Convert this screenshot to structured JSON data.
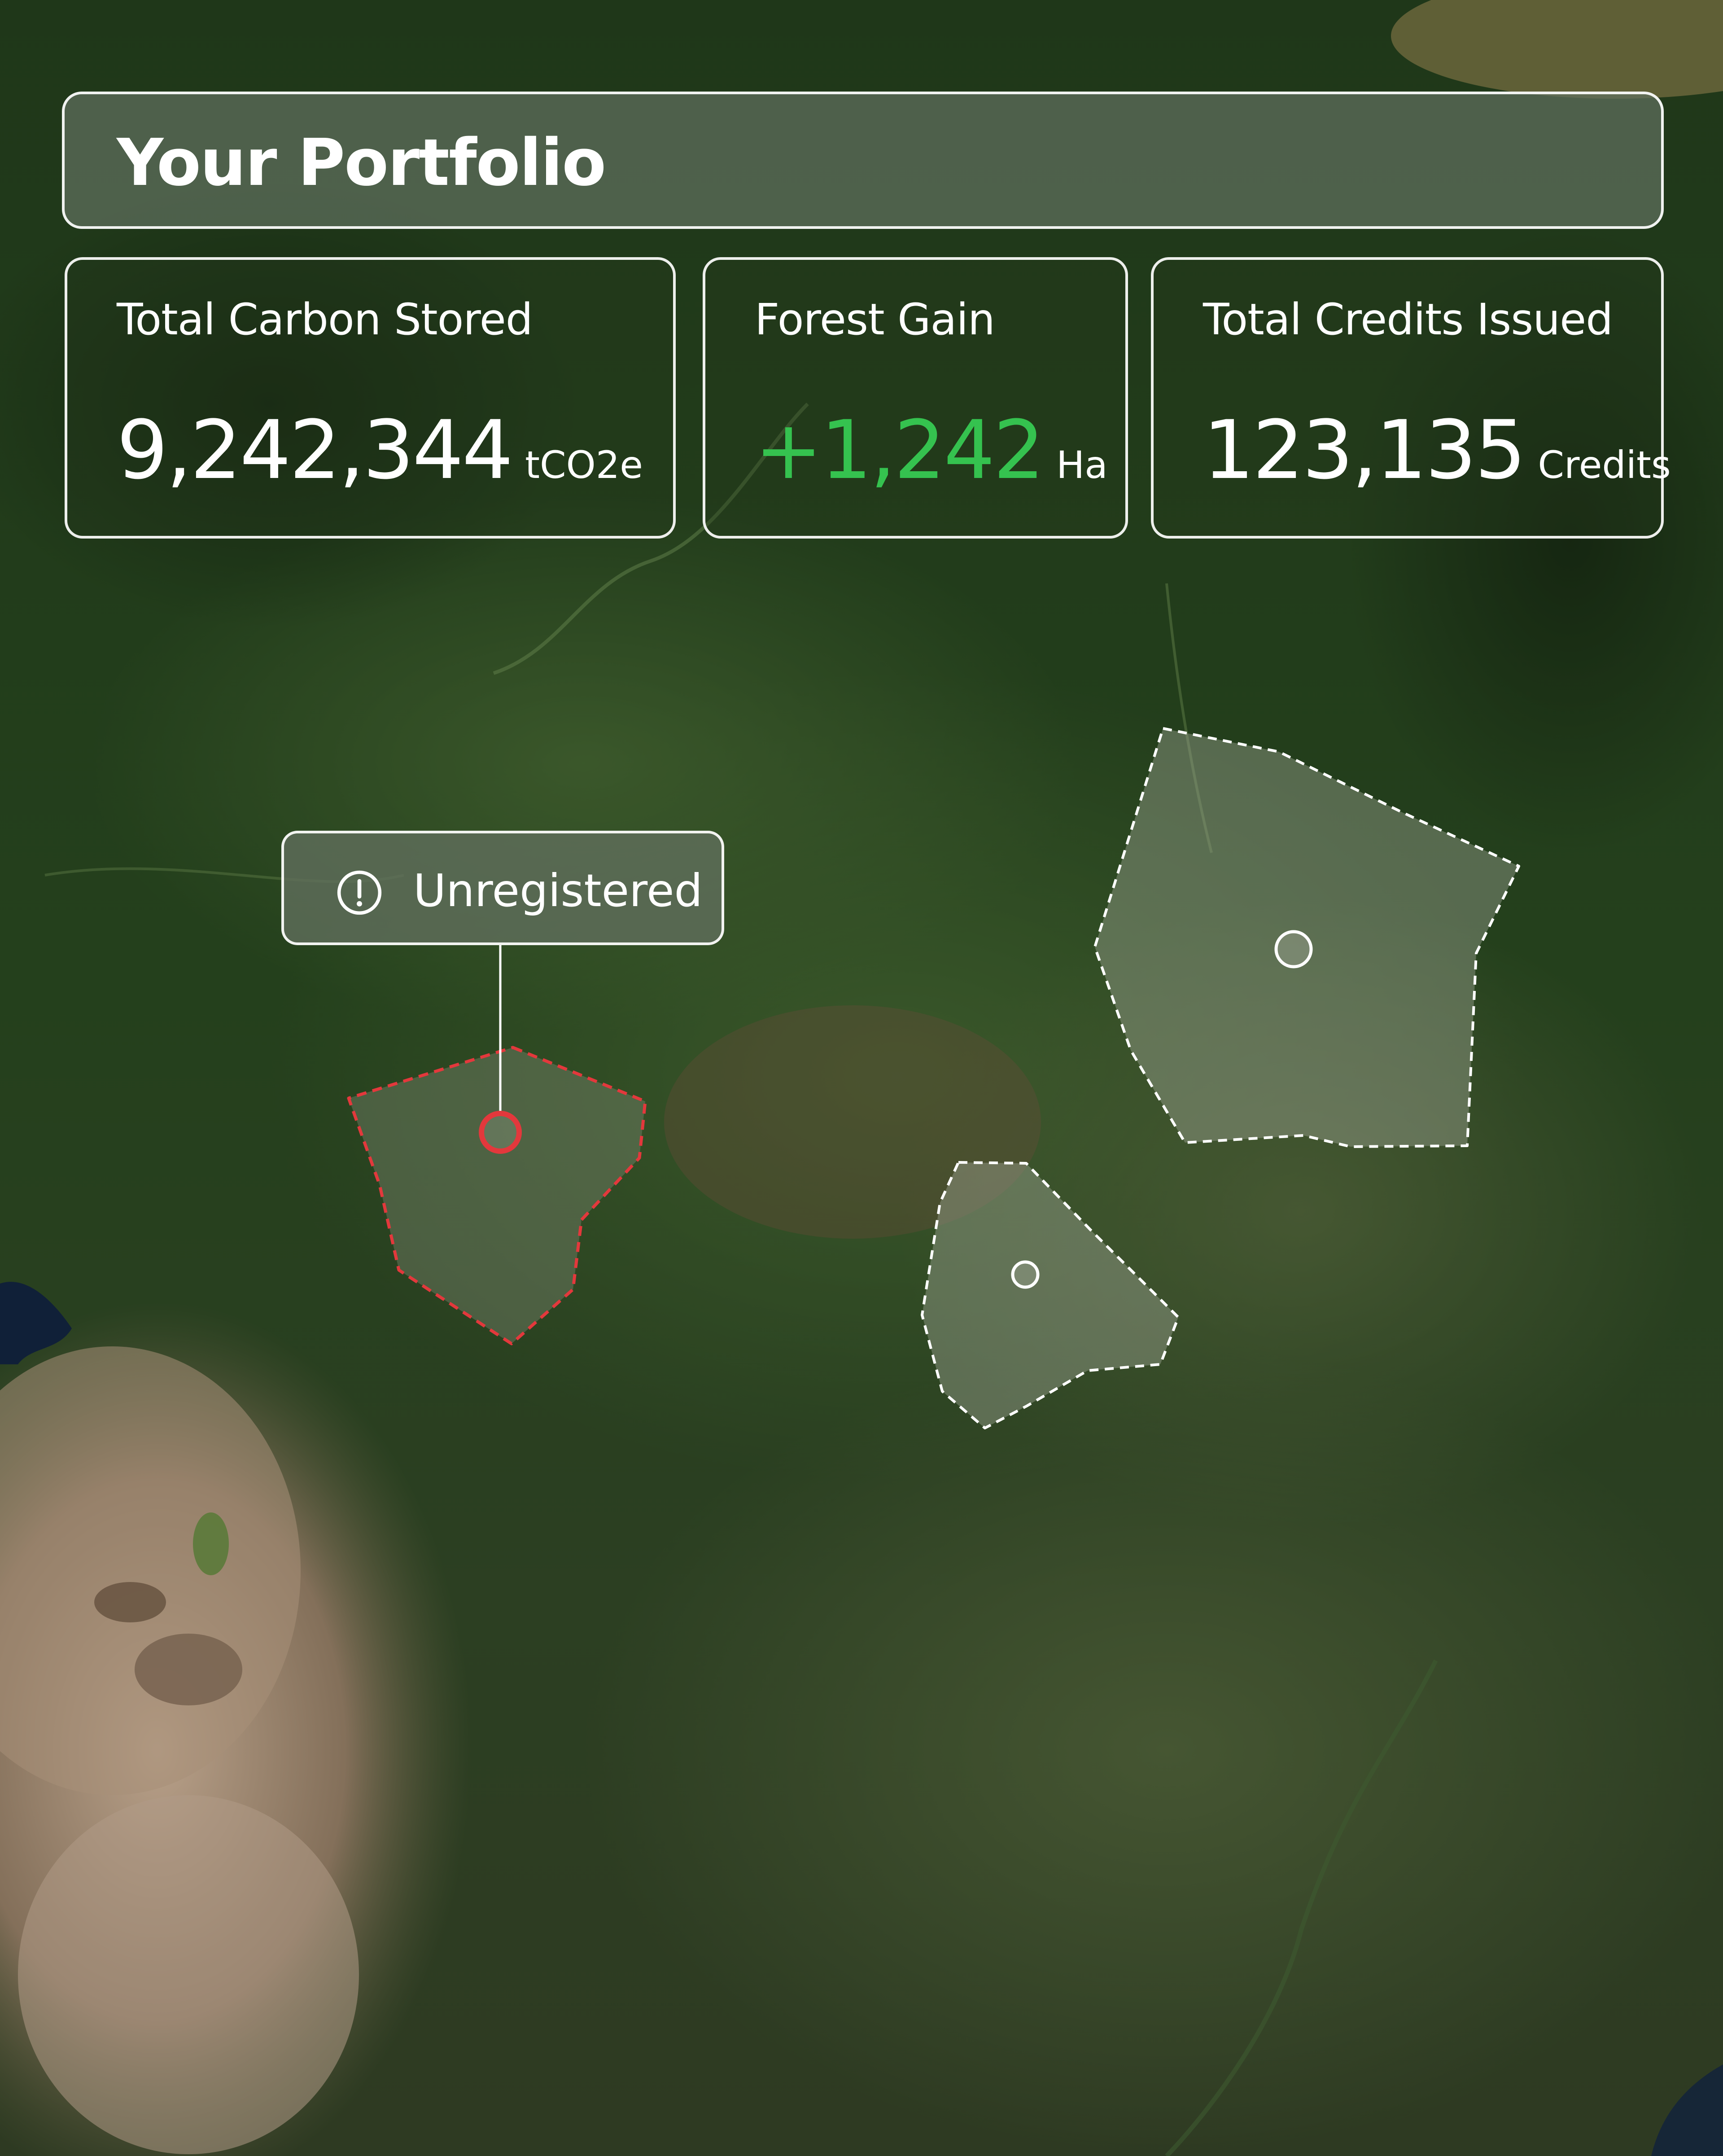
{
  "portfolio": {
    "title": "Your Portfolio"
  },
  "stats": [
    {
      "label": "Total Carbon Stored",
      "value": "9,242,344",
      "unit": "tCO2e"
    },
    {
      "label": "Forest Gain",
      "value": "+1,242",
      "unit": "Ha"
    },
    {
      "label": "Total Credits Issued",
      "value": "123,135",
      "unit": "Credits"
    }
  ],
  "tooltip": {
    "label": "Unregistered",
    "icon": "alert-circle-icon"
  },
  "colors": {
    "gain": "#35c24f",
    "unregistered_outline": "#e3383c",
    "registered_outline": "#ffffff",
    "panel_bg": "#5f6f5c"
  }
}
